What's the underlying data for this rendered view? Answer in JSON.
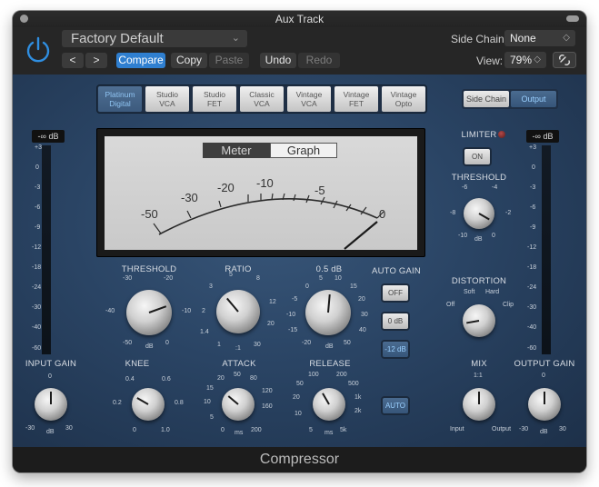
{
  "window": {
    "title": "Aux Track"
  },
  "header": {
    "preset": "Factory Default",
    "prev_label": "<",
    "next_label": ">",
    "compare": "Compare",
    "copy": "Copy",
    "paste": "Paste",
    "undo": "Undo",
    "redo": "Redo",
    "side_chain_label": "Side Chain:",
    "side_chain_value": "None",
    "view_label": "View:",
    "view_value": "79%"
  },
  "models": [
    {
      "line1": "Platinum",
      "line2": "Digital"
    },
    {
      "line1": "Studio",
      "line2": "VCA"
    },
    {
      "line1": "Studio",
      "line2": "FET"
    },
    {
      "line1": "Classic",
      "line2": "VCA"
    },
    {
      "line1": "Vintage",
      "line2": "VCA"
    },
    {
      "line1": "Vintage",
      "line2": "FET"
    },
    {
      "line1": "Vintage",
      "line2": "Opto"
    }
  ],
  "active_model": "Platinum Digital",
  "side_chain_toggle": {
    "side_chain": "Side Chain",
    "output": "Output"
  },
  "meter": {
    "tab_meter": "Meter",
    "tab_graph": "Graph",
    "scale": [
      "-50",
      "-30",
      "-20",
      "-10",
      "-5",
      "0"
    ]
  },
  "input_meter": {
    "readout": "-∞ dB",
    "scale": [
      "+3",
      "0",
      "-3",
      "-6",
      "-9",
      "-12",
      "-18",
      "-24",
      "-30",
      "-40",
      "-60"
    ]
  },
  "output_meter": {
    "readout": "-∞ dB",
    "scale": [
      "+3",
      "0",
      "-3",
      "-6",
      "-9",
      "-12",
      "-18",
      "-24",
      "-30",
      "-40",
      "-60"
    ]
  },
  "knobs": {
    "threshold": {
      "label": "THRESHOLD",
      "ticks": [
        "-30",
        "-20",
        "-40",
        "-10",
        "-50",
        "dB",
        "0"
      ]
    },
    "ratio": {
      "label": "RATIO",
      "ticks": [
        "5",
        "3",
        "8",
        "2",
        "12",
        "1.4",
        "20",
        "1",
        ":1",
        "30"
      ]
    },
    "makeup": {
      "label": "0.5 dB",
      "ticks": [
        "5",
        "10",
        "0",
        "15",
        "-5",
        "20",
        "-10",
        "30",
        "-15",
        "40",
        "-20",
        "dB",
        "50"
      ]
    },
    "input_gain": {
      "label": "INPUT GAIN",
      "ticks": [
        "0",
        "-30",
        "dB",
        "30"
      ]
    },
    "knee": {
      "label": "KNEE",
      "ticks": [
        "0.4",
        "0.6",
        "0.2",
        "0.8",
        "0",
        "1.0"
      ]
    },
    "attack": {
      "label": "ATTACK",
      "ticks": [
        "20",
        "50",
        "80",
        "15",
        "120",
        "10",
        "160",
        "5",
        "200",
        "0",
        "ms"
      ]
    },
    "release": {
      "label": "RELEASE",
      "ticks": [
        "100",
        "200",
        "50",
        "500",
        "20",
        "1k",
        "10",
        "2k",
        "5",
        "ms",
        "5k"
      ]
    },
    "limiter_threshold": {
      "label": "THRESHOLD",
      "ticks": [
        "-6",
        "-4",
        "-8",
        "-2",
        "-10",
        "dB",
        "0"
      ]
    },
    "distortion": {
      "label": "DISTORTION",
      "ticks": [
        "Soft",
        "Hard",
        "Off",
        "Clip"
      ]
    },
    "mix": {
      "label": "MIX",
      "ticks": [
        "1:1",
        "Input",
        "Output"
      ]
    },
    "output_gain": {
      "label": "OUTPUT GAIN",
      "ticks": [
        "0",
        "-30",
        "dB",
        "30"
      ]
    }
  },
  "auto_gain": {
    "label": "AUTO GAIN",
    "off": "OFF",
    "zero": "0 dB",
    "minus12": "-12 dB"
  },
  "auto_release": "AUTO",
  "limiter": {
    "label": "LIMITER",
    "on": "ON"
  },
  "footer": {
    "title": "Compressor"
  },
  "colors": {
    "accent": "#2f7fd0",
    "active_text": "#9ad0ff",
    "panel": "#2a4464"
  }
}
